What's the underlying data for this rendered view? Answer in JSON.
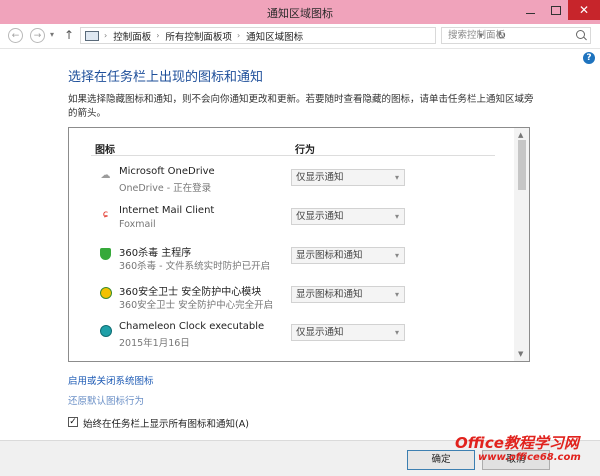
{
  "window": {
    "title": "通知区域图标",
    "close_glyph": "✕"
  },
  "nav": {
    "breadcrumb": [
      "控制面板",
      "所有控制面板项",
      "通知区域图标"
    ],
    "search_placeholder": "搜索控制面板"
  },
  "main": {
    "heading": "选择在任务栏上出现的图标和通知",
    "description": "如果选择隐藏图标和通知，则不会向你通知更改和更新。若要随时查看隐藏的图标，请单击任务栏上通知区域旁的箭头。",
    "col_icon": "图标",
    "col_behavior": "行为",
    "rows": [
      {
        "name": "Microsoft OneDrive",
        "sub": "OneDrive - 正在登录",
        "behavior": "仅显示通知",
        "icon": "cloud-icon"
      },
      {
        "name": "Internet Mail Client",
        "sub": "Foxmail",
        "behavior": "仅显示通知",
        "icon": "foxmail-icon"
      },
      {
        "name": "360杀毒 主程序",
        "sub": "360杀毒 - 文件系统实时防护已开启",
        "behavior": "显示图标和通知",
        "icon": "shield-icon"
      },
      {
        "name": "360安全卫士 安全防护中心模块",
        "sub": "360安全卫士 安全防护中心完全开启",
        "behavior": "显示图标和通知",
        "icon": "guard-icon"
      },
      {
        "name": "Chameleon Clock executable",
        "sub": "2015年1月16日",
        "behavior": "仅显示通知",
        "icon": "clock-icon"
      }
    ],
    "link_toggle": "启用或关闭系统图标",
    "link_restore": "还原默认图标行为",
    "checkbox_label": "始终在任务栏上显示所有图标和通知(A)",
    "checkbox_checked": true
  },
  "footer": {
    "ok": "确定",
    "cancel": "取消"
  },
  "watermark": {
    "line1": "Office教程学习网",
    "line2": "www.office68.com"
  }
}
